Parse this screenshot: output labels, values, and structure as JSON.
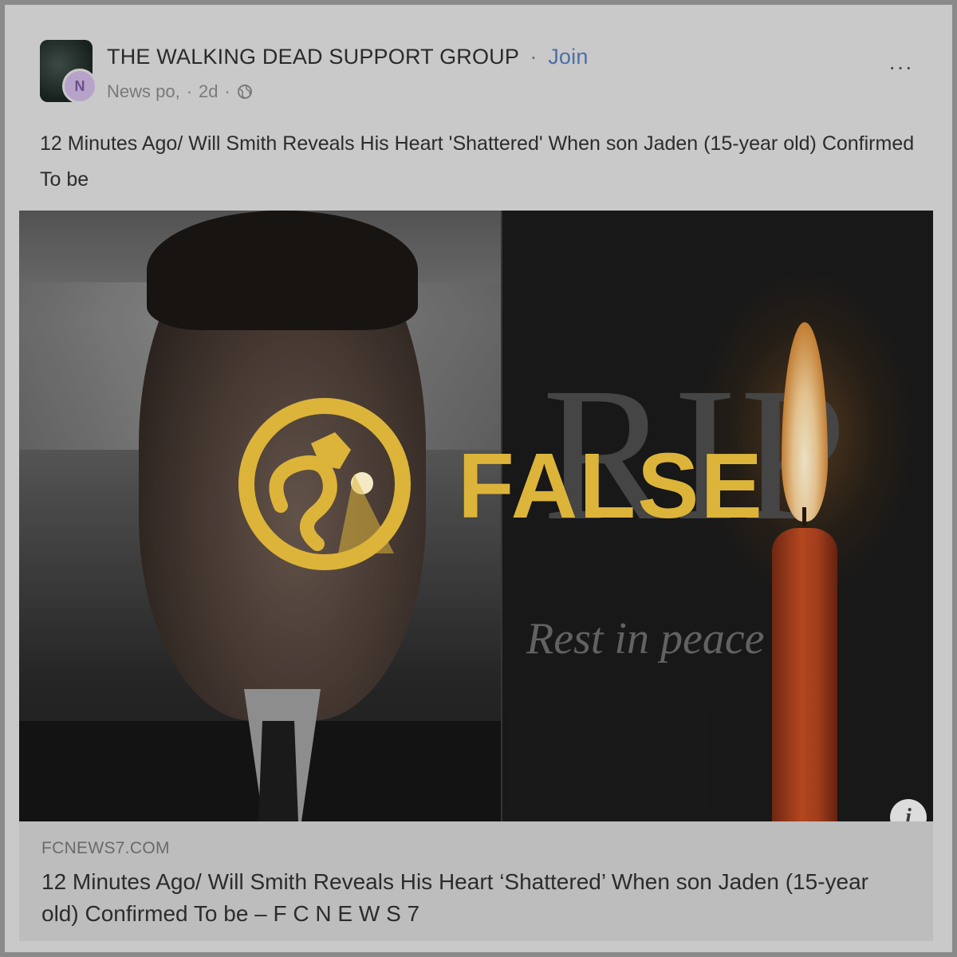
{
  "post": {
    "group_name": "THE WALKING DEAD SUPPORT GROUP",
    "separator": "·",
    "join_label": "Join",
    "user_initial": "N",
    "author": "News po,",
    "time": "2d",
    "more": "···",
    "text": "12 Minutes Ago/ Will Smith Reveals His Heart 'Shattered' When son Jaden (15-year old) Confirmed To be"
  },
  "media": {
    "rip": "RIP",
    "rest_in_peace": "Rest in peace",
    "info": "i"
  },
  "factcheck": {
    "rating": "FALSE",
    "accent_color": "#dcb43a"
  },
  "link_preview": {
    "domain": "FCNEWS7.COM",
    "title": "12 Minutes Ago/ Will Smith Reveals His Heart ‘Shattered’ When son Jaden (15-year old) Confirmed To be – F C N E W S 7"
  }
}
